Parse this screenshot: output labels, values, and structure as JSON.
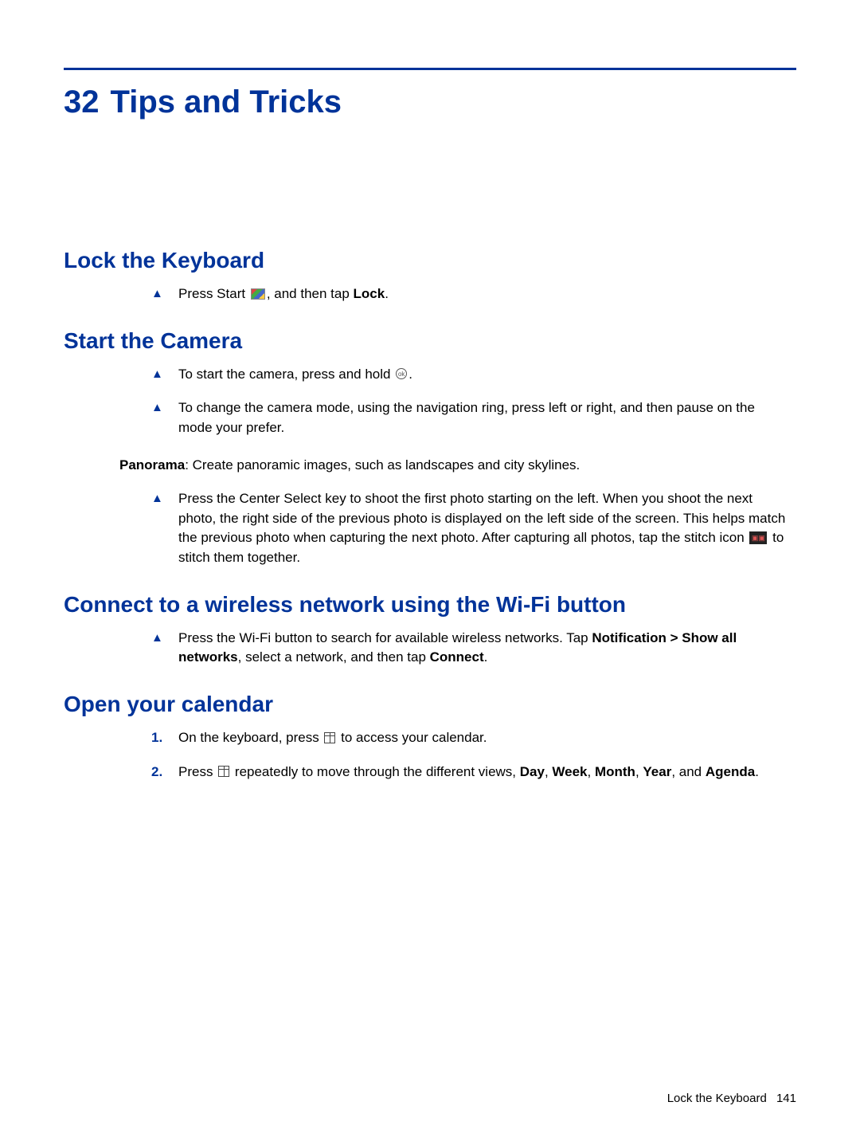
{
  "chapter": {
    "number": "32",
    "title": "Tips and Tricks"
  },
  "sections": {
    "lock": {
      "title": "Lock the Keyboard",
      "item1_pre": "Press Start ",
      "item1_post": ", and then tap ",
      "item1_bold": "Lock",
      "item1_end": "."
    },
    "camera": {
      "title": "Start the Camera",
      "item1_pre": "To start the camera, press and hold ",
      "item1_post": ".",
      "item2": "To change the camera mode, using the navigation ring, press left or right, and then pause on the mode your prefer.",
      "panorama_label": "Panorama",
      "panorama_text": ": Create panoramic images, such as landscapes and city skylines.",
      "item3_pre": "Press the Center Select key to shoot the first photo starting on the left. When you shoot the next photo, the right side of the previous photo is displayed on the left side of the screen. This helps match the previous photo when capturing the next photo. After capturing all photos, tap the stitch icon ",
      "item3_post": " to stitch them together."
    },
    "wifi": {
      "title": "Connect to a wireless network using the Wi-Fi button",
      "item1_pre": "Press the Wi-Fi button to search for available wireless networks. Tap ",
      "item1_bold1": "Notification > Show all networks",
      "item1_mid": ", select a network, and then tap ",
      "item1_bold2": "Connect",
      "item1_end": "."
    },
    "calendar": {
      "title": "Open your calendar",
      "item1_num": "1.",
      "item1_pre": "On the keyboard, press ",
      "item1_post": " to access your calendar.",
      "item2_num": "2.",
      "item2_pre": "Press ",
      "item2_mid": " repeatedly to move through the different views, ",
      "item2_views": {
        "day": "Day",
        "week": "Week",
        "month": "Month",
        "year": "Year",
        "agenda": "Agenda"
      },
      "item2_and": ", and ",
      "item2_sep": ", ",
      "item2_end": "."
    }
  },
  "footer": {
    "text": "Lock the Keyboard",
    "page": "141"
  }
}
